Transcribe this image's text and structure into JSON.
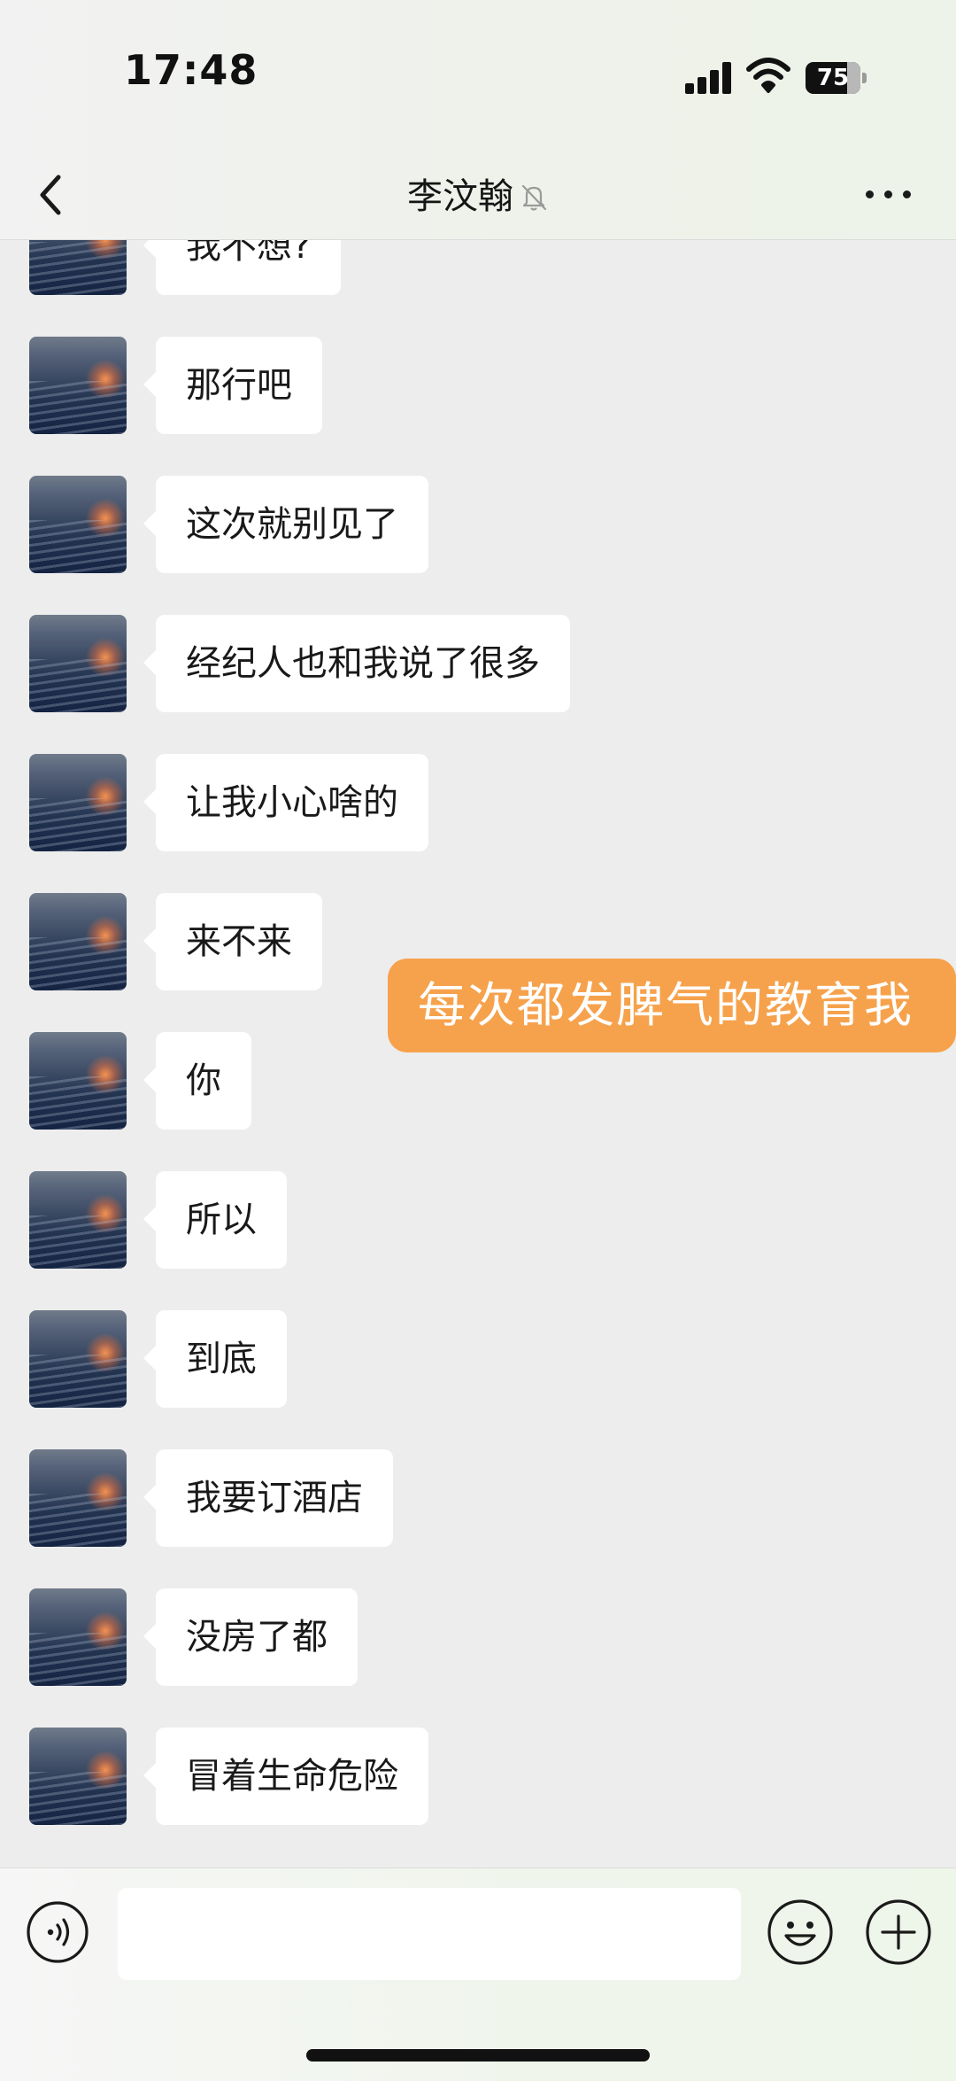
{
  "status_bar": {
    "time": "17:48",
    "battery": "75"
  },
  "nav": {
    "title": "李汶翰",
    "icons": {
      "back": "chevron-left-icon",
      "mute": "bell-slash-icon",
      "more": "more-horizontal-icon"
    }
  },
  "messages": [
    {
      "text": "我不想?"
    },
    {
      "text": "那行吧"
    },
    {
      "text": "这次就别见了"
    },
    {
      "text": "经纪人也和我说了很多"
    },
    {
      "text": "让我小心啥的"
    },
    {
      "text": "来不来"
    },
    {
      "text": "你"
    },
    {
      "text": "所以"
    },
    {
      "text": "到底"
    },
    {
      "text": "我要订酒店"
    },
    {
      "text": "没房了都"
    },
    {
      "text": "冒着生命危险"
    }
  ],
  "overlay": {
    "caption": "每次都发脾气的教育我",
    "color": "#f6a24c"
  },
  "input_bar": {
    "input_value": "",
    "icons": {
      "voice": "voice-icon",
      "emoji": "emoji-icon",
      "plus": "plus-circle-icon"
    }
  },
  "colors": {
    "background": "#ededed",
    "bubble": "#ffffff",
    "text": "#191919"
  }
}
